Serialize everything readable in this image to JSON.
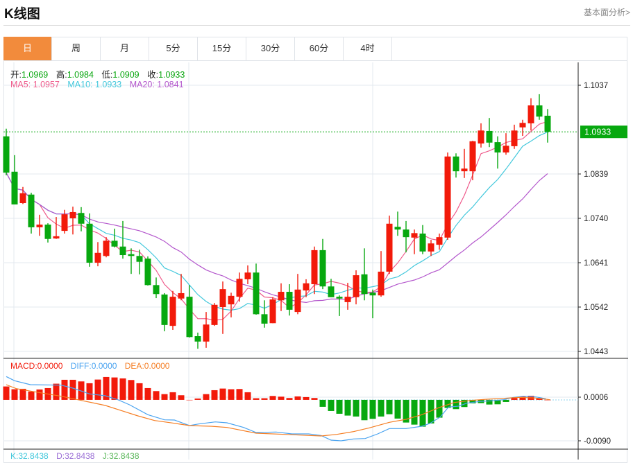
{
  "header": {
    "title": "K线图",
    "link": "基本面分析>"
  },
  "tabs": [
    {
      "label": "日",
      "active": true
    },
    {
      "label": "周"
    },
    {
      "label": "月"
    },
    {
      "label": "5分"
    },
    {
      "label": "15分"
    },
    {
      "label": "30分"
    },
    {
      "label": "60分"
    },
    {
      "label": "4时"
    }
  ],
  "ohlc": {
    "open_label": "开:",
    "open": "1.0969",
    "high_label": "高:",
    "high": "1.0984",
    "low_label": "低:",
    "low": "1.0909",
    "close_label": "收:",
    "close": "1.0933"
  },
  "ma": {
    "ma5": "MA5: 1.0957",
    "ma10": "MA10: 1.0933",
    "ma20": "MA20: 1.0841"
  },
  "macd_legend": {
    "macd": "MACD:0.0000",
    "diff": "DIFF:0.0000",
    "dea": "DEA:0.0000"
  },
  "kdj_legend": {
    "k": "K:32.8438",
    "d": "D:32.8438",
    "j": "J:32.8438"
  },
  "colors": {
    "up": "#f21a0a",
    "down": "#07a80f",
    "ma5": "#ef5b8c",
    "ma10": "#43c8dc",
    "ma20": "#b356cc",
    "diff": "#4aa3f0",
    "dea": "#f57d22",
    "accent": "#f28b3c"
  },
  "chart_data": {
    "type": "candlestick",
    "price_axis": {
      "ticks": [
        "1.1037",
        "1.0839",
        "1.0740",
        "1.0641",
        "1.0542",
        "1.0443"
      ],
      "range": [
        1.0443,
        1.1037
      ],
      "last_price": "1.0933"
    },
    "candles": [
      [
        1.0923,
        1.094,
        1.0836,
        1.0842
      ],
      [
        1.0844,
        1.0881,
        1.0771,
        1.0771
      ],
      [
        1.0774,
        1.081,
        1.0772,
        1.0796
      ],
      [
        1.0793,
        1.0797,
        1.0706,
        1.072
      ],
      [
        1.072,
        1.0748,
        1.0701,
        1.0726
      ],
      [
        1.0726,
        1.0729,
        1.0686,
        1.0694
      ],
      [
        1.0695,
        1.0743,
        1.0694,
        1.07
      ],
      [
        1.0712,
        1.0759,
        1.0706,
        1.0749
      ],
      [
        1.074,
        1.0766,
        1.0704,
        1.0754
      ],
      [
        1.0752,
        1.0765,
        1.0711,
        1.0728
      ],
      [
        1.0728,
        1.0751,
        1.0632,
        1.0641
      ],
      [
        1.0641,
        1.0687,
        1.0633,
        1.0663
      ],
      [
        1.0656,
        1.0698,
        1.0653,
        1.069
      ],
      [
        1.069,
        1.0717,
        1.0675,
        1.0677
      ],
      [
        1.0677,
        1.0734,
        1.065,
        1.0658
      ],
      [
        1.066,
        1.0673,
        1.0616,
        1.0656
      ],
      [
        1.0656,
        1.067,
        1.0615,
        1.0643
      ],
      [
        1.065,
        1.0655,
        1.059,
        1.0591
      ],
      [
        1.0591,
        1.0608,
        1.0562,
        1.0571
      ],
      [
        1.057,
        1.0573,
        1.0488,
        1.0502
      ],
      [
        1.05,
        1.0578,
        1.0491,
        1.0565
      ],
      [
        1.0561,
        1.0616,
        1.0557,
        1.0573
      ],
      [
        1.0565,
        1.0591,
        1.0474,
        1.0475
      ],
      [
        1.0477,
        1.0485,
        1.0449,
        1.0465
      ],
      [
        1.0465,
        1.0531,
        1.0451,
        1.0503
      ],
      [
        1.0502,
        1.0551,
        1.05,
        1.0547
      ],
      [
        1.0542,
        1.0599,
        1.0482,
        1.0582
      ],
      [
        1.0548,
        1.0574,
        1.0519,
        1.0567
      ],
      [
        1.0565,
        1.0619,
        1.0554,
        1.0605
      ],
      [
        1.0604,
        1.0635,
        1.0593,
        1.0619
      ],
      [
        1.0619,
        1.0639,
        1.0525,
        1.0526
      ],
      [
        1.0526,
        1.0557,
        1.0496,
        1.0505
      ],
      [
        1.0506,
        1.0564,
        1.0506,
        1.0559
      ],
      [
        1.0557,
        1.0595,
        1.0533,
        1.0576
      ],
      [
        1.0576,
        1.0593,
        1.0523,
        1.0536
      ],
      [
        1.0531,
        1.0616,
        1.0526,
        1.0581
      ],
      [
        1.0579,
        1.0604,
        1.0564,
        1.0595
      ],
      [
        1.0593,
        1.0677,
        1.0571,
        1.0669
      ],
      [
        1.0669,
        1.0694,
        1.0582,
        1.0588
      ],
      [
        1.0588,
        1.0605,
        1.0564,
        1.0564
      ],
      [
        1.0565,
        1.0568,
        1.0522,
        1.0561
      ],
      [
        1.0553,
        1.0596,
        1.0536,
        1.0565
      ],
      [
        1.0564,
        1.0624,
        1.0548,
        1.0613
      ],
      [
        1.0615,
        1.0673,
        1.0557,
        1.0571
      ],
      [
        1.0574,
        1.0581,
        1.0517,
        1.0568
      ],
      [
        1.0568,
        1.0667,
        1.0565,
        1.0621
      ],
      [
        1.0621,
        1.0746,
        1.0616,
        1.0728
      ],
      [
        1.0721,
        1.0755,
        1.0701,
        1.0715
      ],
      [
        1.0715,
        1.0734,
        1.0664,
        1.0698
      ],
      [
        1.0697,
        1.0715,
        1.066,
        1.0707
      ],
      [
        1.0706,
        1.0725,
        1.066,
        1.0666
      ],
      [
        1.0666,
        1.0692,
        1.0656,
        1.0684
      ],
      [
        1.0681,
        1.0706,
        1.067,
        1.0698
      ],
      [
        1.0697,
        1.0887,
        1.0692,
        1.0878
      ],
      [
        1.0878,
        1.0885,
        1.0831,
        1.0845
      ],
      [
        1.0845,
        1.0895,
        1.083,
        1.0851
      ],
      [
        1.0845,
        1.0913,
        1.0825,
        1.0912
      ],
      [
        1.0907,
        1.0952,
        1.0898,
        1.0936
      ],
      [
        1.0935,
        1.0964,
        1.0899,
        1.0909
      ],
      [
        1.091,
        1.0923,
        1.0851,
        1.0887
      ],
      [
        1.0887,
        1.093,
        1.0882,
        1.0902
      ],
      [
        1.0901,
        1.0949,
        1.0895,
        1.0936
      ],
      [
        1.0943,
        1.096,
        1.0924,
        1.0953
      ],
      [
        1.0952,
        1.1008,
        1.0936,
        1.0992
      ],
      [
        1.0992,
        1.1017,
        1.096,
        1.0967
      ],
      [
        1.0969,
        1.0984,
        1.0909,
        1.0933
      ]
    ],
    "candle_fields": [
      "open",
      "high",
      "low",
      "close"
    ],
    "macd": {
      "ticks": [
        "0.0006",
        "-0.0090"
      ],
      "histogram": [
        0.00295,
        0.00234,
        0.00244,
        0.00183,
        0.00229,
        0.00259,
        0.00356,
        0.00442,
        0.00442,
        0.00406,
        0.00366,
        0.00447,
        0.00503,
        0.00493,
        0.00472,
        0.00437,
        0.00366,
        0.00259,
        0.00193,
        0.00127,
        0.00168,
        0.00102,
        0,
        0.0003,
        0.00127,
        0.00213,
        0.00249,
        0.00234,
        0.00239,
        0.00168,
        0.00036,
        0.00036,
        0.00086,
        0.00071,
        0.00041,
        0.00076,
        0.00061,
        0.00041,
        -0.00152,
        -0.00244,
        -0.00305,
        -0.00345,
        -0.00366,
        -0.00447,
        -0.00417,
        -0.00366,
        -0.00315,
        -0.00411,
        -0.00498,
        -0.00544,
        -0.00589,
        -0.00518,
        -0.00391,
        -0.00178,
        -0.00203,
        -0.00157,
        -0.00076,
        -0.00071,
        -0.00102,
        -0.00097,
        -0.00046,
        0.00041,
        0.00071,
        0.00091,
        0.00041,
        0
      ],
      "diff": [
        [
          0,
          0.00512
        ],
        [
          1,
          0.00421
        ],
        [
          2.9,
          0.00334
        ],
        [
          6.6,
          0.00324
        ],
        [
          8,
          0.00258
        ],
        [
          10,
          0.00131
        ],
        [
          11.9,
          0.0009
        ],
        [
          13.4,
          4e-05
        ],
        [
          14.8,
          -0.00108
        ],
        [
          17,
          -0.00326
        ],
        [
          19,
          -0.00438
        ],
        [
          20.2,
          -0.00443
        ],
        [
          22,
          -0.00565
        ],
        [
          23.1,
          -0.0053
        ],
        [
          25.1,
          -0.00484
        ],
        [
          26.5,
          -0.00504
        ],
        [
          28.5,
          -0.00606
        ],
        [
          30,
          -0.00717
        ],
        [
          32.4,
          -0.00707
        ],
        [
          34.3,
          -0.00748
        ],
        [
          36.3,
          -0.00748
        ],
        [
          37.8,
          -0.00783
        ],
        [
          39,
          -0.00885
        ],
        [
          40.2,
          -0.009
        ],
        [
          41.7,
          -0.00859
        ],
        [
          43.1,
          -0.0085
        ],
        [
          44.6,
          -0.00748
        ],
        [
          46,
          -0.0063
        ],
        [
          48,
          -0.0063
        ],
        [
          49.9,
          -0.0058
        ],
        [
          50.9,
          -0.00514
        ],
        [
          52.1,
          -0.00377
        ],
        [
          53.1,
          -0.00158
        ],
        [
          54.3,
          -0.00138
        ],
        [
          55.3,
          -0.00073
        ],
        [
          56.8,
          -0.00036
        ],
        [
          58.2,
          -0.00021
        ],
        [
          59.7,
          4e-05
        ],
        [
          60.9,
          0.00055
        ],
        [
          62.1,
          0.0008
        ],
        [
          63.6,
          0.00065
        ],
        [
          64.8,
          0.00025
        ]
      ],
      "dea": [
        [
          0,
          0.00334
        ],
        [
          1.2,
          0.00247
        ],
        [
          4.1,
          0.00156
        ],
        [
          6.6,
          0.0008
        ],
        [
          9,
          -0.00012
        ],
        [
          11.9,
          -0.00123
        ],
        [
          13.9,
          -0.0024
        ],
        [
          15.8,
          -0.00351
        ],
        [
          17.8,
          -0.00454
        ],
        [
          20.2,
          -0.00514
        ],
        [
          22,
          -0.00565
        ],
        [
          24.6,
          -0.0058
        ],
        [
          26.5,
          -0.00606
        ],
        [
          30,
          -0.00732
        ],
        [
          33.4,
          -0.00758
        ],
        [
          37.8,
          -0.00793
        ],
        [
          39.7,
          -0.00758
        ],
        [
          41.7,
          -0.00697
        ],
        [
          43.6,
          -0.00615
        ],
        [
          46,
          -0.00493
        ],
        [
          48,
          -0.00428
        ],
        [
          49.9,
          -0.00326
        ],
        [
          51.9,
          -0.00173
        ],
        [
          53.8,
          -0.00057
        ],
        [
          55.8,
          -0.00012
        ],
        [
          57.7,
          0.00014
        ],
        [
          59.7,
          0.00034
        ],
        [
          61.6,
          0.00055
        ],
        [
          63.6,
          0.0004
        ],
        [
          65.3,
          4e-05
        ]
      ]
    }
  }
}
